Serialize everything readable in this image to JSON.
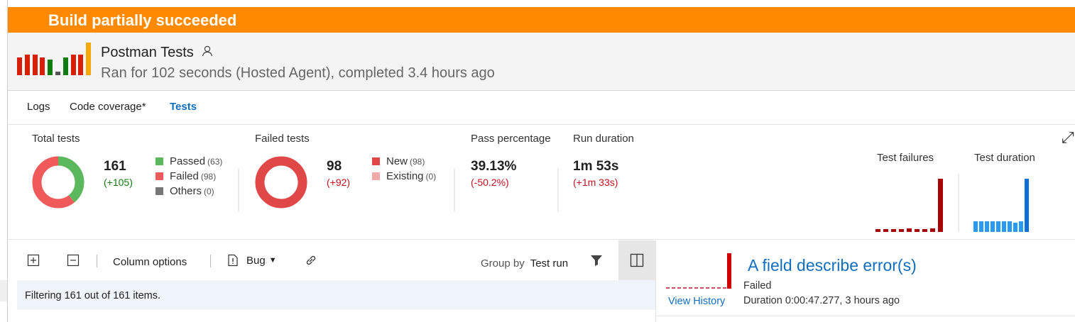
{
  "banner": {
    "text": "Build partially succeeded"
  },
  "build": {
    "title": "Postman Tests",
    "subtitle": "Ran for 102 seconds (Hosted Agent), completed 3.4 hours ago",
    "history_bars": [
      {
        "h": 0.55,
        "color": "#d81e05"
      },
      {
        "h": 0.62,
        "color": "#d81e05"
      },
      {
        "h": 0.62,
        "color": "#d81e05"
      },
      {
        "h": 0.55,
        "color": "#d81e05"
      },
      {
        "h": 0.48,
        "color": "#107c10"
      },
      {
        "h": 0.1,
        "color": "#555555"
      },
      {
        "h": 0.55,
        "color": "#107c10"
      },
      {
        "h": 0.62,
        "color": "#d81e05"
      },
      {
        "h": 0.62,
        "color": "#d81e05"
      },
      {
        "h": 1.0,
        "color": "#f7a800"
      }
    ]
  },
  "tabs": [
    {
      "label": "Logs",
      "active": false
    },
    {
      "label": "Code coverage*",
      "active": false
    },
    {
      "label": "Tests",
      "active": true
    }
  ],
  "summary": {
    "total": {
      "label": "Total tests",
      "value": "161",
      "delta": "(+105)",
      "legend": [
        {
          "label": "Passed",
          "count": "(63)",
          "color": "#5cb85c",
          "value": 63
        },
        {
          "label": "Failed",
          "count": "(98)",
          "color": "#f05a5a",
          "value": 98
        },
        {
          "label": "Others",
          "count": "(0)",
          "color": "#777777",
          "value": 0
        }
      ]
    },
    "failed": {
      "label": "Failed tests",
      "value": "98",
      "delta": "(+92)",
      "legend": [
        {
          "label": "New",
          "count": "(98)",
          "color": "#e04848",
          "value": 98
        },
        {
          "label": "Existing",
          "count": "(0)",
          "color": "#f4a9a9",
          "value": 0
        }
      ]
    },
    "pass_percentage": {
      "label": "Pass percentage",
      "value": "39.13%",
      "delta": "(-50.2%)"
    },
    "run_duration": {
      "label": "Run duration",
      "value": "1m 53s",
      "delta": "(+1m 33s)"
    },
    "test_failures": {
      "label": "Test failures",
      "bars": [
        0.05,
        0.05,
        0.05,
        0.05,
        0.07,
        0.05,
        0.05,
        0.07,
        1.0
      ],
      "color": "#a80000"
    },
    "test_duration": {
      "label": "Test duration",
      "bars": [
        0.2,
        0.2,
        0.2,
        0.2,
        0.2,
        0.2,
        0.2,
        0.17,
        0.2,
        1.0
      ],
      "colors": [
        "#2b9af3",
        "#2b9af3",
        "#2b9af3",
        "#2b9af3",
        "#2b9af3",
        "#2b9af3",
        "#2b9af3",
        "#2b9af3",
        "#2b9af3",
        "#0f6fd8"
      ]
    }
  },
  "toolbar": {
    "column_options": "Column options",
    "bug": "Bug",
    "group_by_label": "Group by",
    "group_by_value": "Test run"
  },
  "filter": {
    "text": "Filtering 161 out of 161 items."
  },
  "detail": {
    "title": "A field describe error(s)",
    "status": "Failed",
    "duration": "Duration 0:00:47.277, 3 hours ago",
    "view_history": "View History"
  }
}
